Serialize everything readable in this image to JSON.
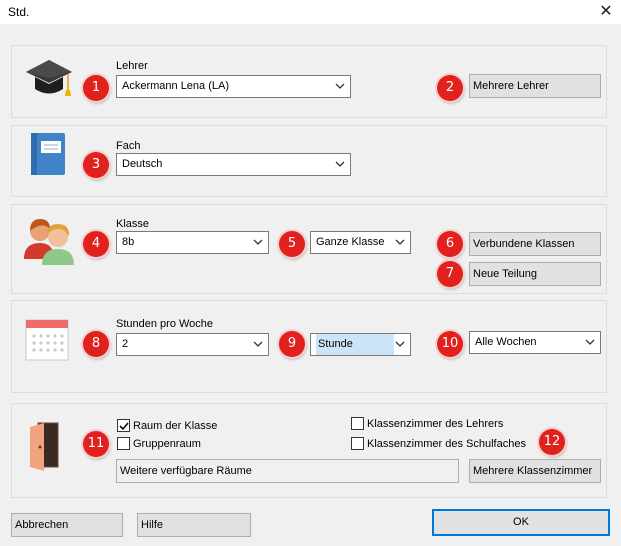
{
  "window": {
    "title": "Std.",
    "close_glyph": "✕"
  },
  "teacher": {
    "label": "Lehrer",
    "value": "Ackermann Lena (LA)",
    "badge": "1",
    "multi_badge": "2",
    "multi_button": "Mehrere Lehrer",
    "icon": "graduation-cap-icon"
  },
  "subject": {
    "label": "Fach",
    "value": "Deutsch",
    "badge": "3",
    "icon": "book-icon"
  },
  "class": {
    "label": "Klasse",
    "value": "8b",
    "badge": "4",
    "part_badge": "5",
    "part_value": "Ganze Klasse",
    "linked_badge": "6",
    "linked_button": "Verbundene Klassen",
    "split_badge": "7",
    "split_button": "Neue Teilung",
    "icon": "students-icon"
  },
  "hours": {
    "label": "Stunden pro Woche",
    "value": "2",
    "badge": "8",
    "unit_badge": "9",
    "unit_value": "Stunde",
    "weeks_badge": "10",
    "weeks_value": "Alle Wochen",
    "icon": "calendar-icon"
  },
  "rooms": {
    "badge": "11",
    "class_room_label": "Raum der Klasse",
    "class_room_checked": true,
    "group_room_label": "Gruppenraum",
    "group_room_checked": false,
    "teacher_room_label": "Klassenzimmer des Lehrers",
    "teacher_room_checked": false,
    "subject_room_label": "Klassenzimmer des Schulfaches",
    "subject_room_checked": false,
    "more_rooms_badge": "12",
    "available_rooms_field": "Weitere verfügbare Räume",
    "more_rooms_button": "Mehrere Klassenzimmer",
    "icon": "door-icon"
  },
  "footer": {
    "cancel": "Abbrechen",
    "help": "Hilfe",
    "ok": "OK"
  },
  "colors": {
    "badge_red": "#e0211e",
    "dialog_bg": "#f0f0f0",
    "highlight": "#cce4f7",
    "ok_border": "#0078d7"
  }
}
